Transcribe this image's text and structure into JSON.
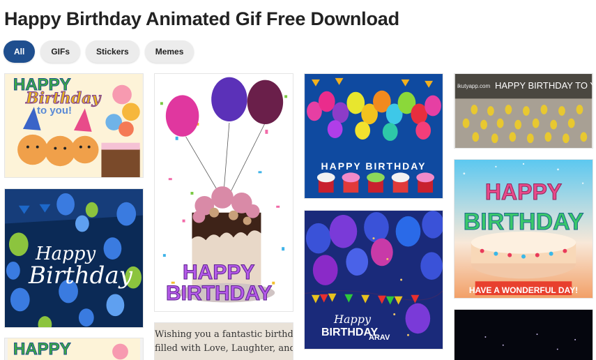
{
  "page": {
    "title": "Happy Birthday Animated Gif Free Download"
  },
  "filters": [
    {
      "label": "All",
      "active": true
    },
    {
      "label": "GIFs",
      "active": false
    },
    {
      "label": "Stickers",
      "active": false
    },
    {
      "label": "Memes",
      "active": false
    }
  ],
  "cards": {
    "cats": {
      "line1": "HAPPY",
      "line2": "Birthday",
      "line3": "to you!"
    },
    "cake_balloons": {
      "line1": "HAPPY",
      "line2": "BIRTHDAY"
    },
    "rainbow_balloons": {
      "caption": "HAPPY BIRTHDAY"
    },
    "minions": {
      "watermark": "ikutyapp.com",
      "caption": "HAPPY BIRTHDAY TO YOU"
    },
    "blue_balloons": {
      "line1": "Happy",
      "line2": "Birthday"
    },
    "candle_cake": {
      "line1": "HAPPY",
      "line2": "BIRTHDAY",
      "caption": "HAVE A WONDERFUL DAY!"
    },
    "purple_balloons": {
      "line1": "Happy",
      "line2": "BIRTHDAY",
      "name": "ARAV"
    },
    "wishing": {
      "line1": "Wishing you a fantastic birthday",
      "line2": "filled with Love, Laughter, and"
    },
    "cats_repeat": {
      "line1": "HAPPY"
    }
  },
  "colors": {
    "accent": "#1f4f8f",
    "chip_bg": "#ececec"
  }
}
